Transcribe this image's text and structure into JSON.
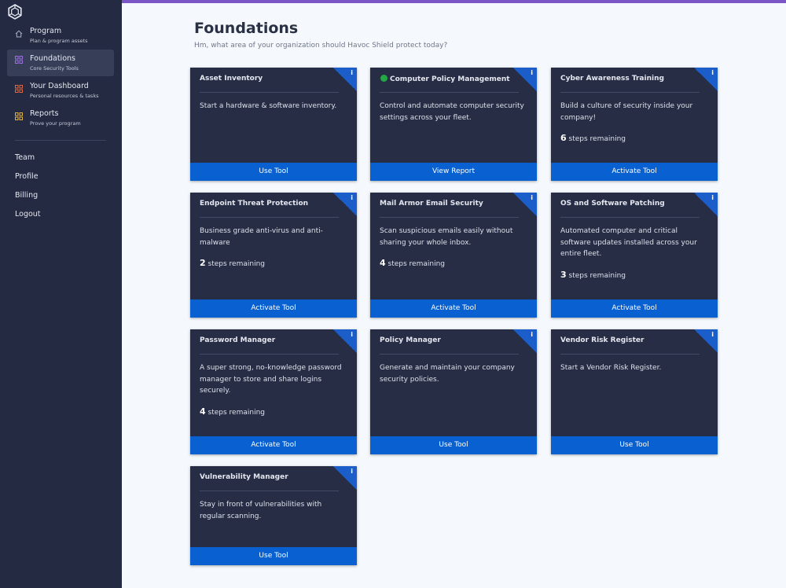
{
  "colors": {
    "sidebar": "#232a41",
    "accent_bar": "#7b57c6",
    "card": "#262d45",
    "button": "#0961d1",
    "status_ok": "#22a844"
  },
  "sidebar": {
    "logo": "havoc-shield-logo",
    "nav": [
      {
        "title": "Program",
        "subtitle": "Plan & program assets",
        "icon": "home-icon"
      },
      {
        "title": "Foundations",
        "subtitle": "Core Security Tools",
        "icon": "grid-icon",
        "active": true
      },
      {
        "title": "Your Dashboard",
        "subtitle": "Personal resources & tasks",
        "icon": "grid-icon"
      },
      {
        "title": "Reports",
        "subtitle": "Prove your program",
        "icon": "grid-icon"
      }
    ],
    "links": [
      "Team",
      "Profile",
      "Billing",
      "Logout"
    ]
  },
  "page": {
    "title": "Foundations",
    "subtitle": "Hm, what area of your organization should Havoc Shield protect today?"
  },
  "info_label": "i",
  "steps_label": "steps remaining",
  "cards": [
    {
      "title": "Asset Inventory",
      "desc": "Start a hardware & software inventory.",
      "steps": "",
      "button": "Use Tool"
    },
    {
      "title": "Computer Policy Management",
      "desc": "Control and automate computer security settings across your fleet.",
      "steps": "",
      "button": "View Report",
      "status": "active"
    },
    {
      "title": "Cyber Awareness Training",
      "desc": "Build a culture of security inside your company!",
      "steps": "6",
      "button": "Activate Tool"
    },
    {
      "title": "Endpoint Threat Protection",
      "desc": "Business grade anti-virus and anti-malware",
      "steps": "2",
      "button": "Activate Tool"
    },
    {
      "title": "Mail Armor Email Security",
      "desc": "Scan suspicious emails easily without sharing your whole inbox.",
      "steps": "4",
      "button": "Activate Tool"
    },
    {
      "title": "OS and Software Patching",
      "desc": "Automated computer and critical software updates installed across your entire fleet.",
      "steps": "3",
      "button": "Activate Tool"
    },
    {
      "title": "Password Manager",
      "desc": "A super strong, no-knowledge password manager to store and share logins securely.",
      "steps": "4",
      "button": "Activate Tool"
    },
    {
      "title": "Policy Manager",
      "desc": "Generate and maintain your company security policies.",
      "steps": "",
      "button": "Use Tool"
    },
    {
      "title": "Vendor Risk Register",
      "desc": "Start a Vendor Risk Register.",
      "steps": "",
      "button": "Use Tool"
    },
    {
      "title": "Vulnerability Manager",
      "desc": "Stay in front of vulnerabilities with regular scanning.",
      "steps": "",
      "button": "Use Tool"
    }
  ]
}
